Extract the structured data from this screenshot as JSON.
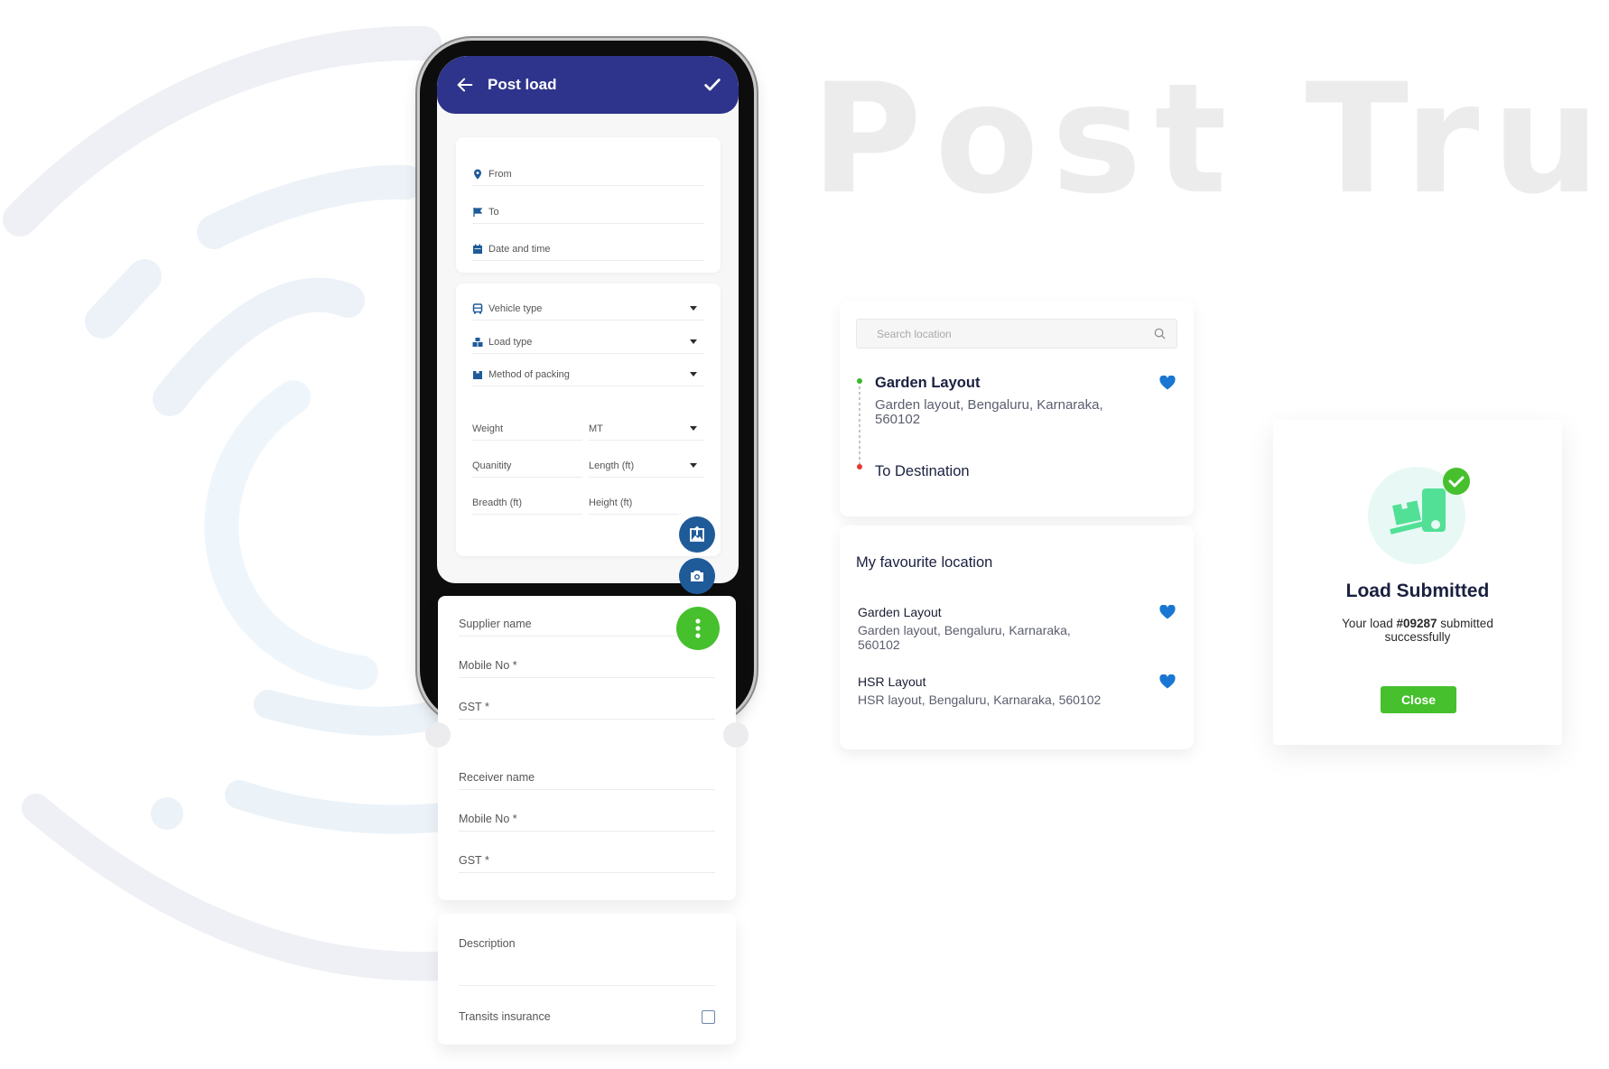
{
  "hero": {
    "title": "Post Truck"
  },
  "colors": {
    "header": "#2e348c",
    "accent_blue": "#1f5b99",
    "accent_green": "#46c02d",
    "heart_blue": "#1976d2",
    "route_start": "#3cb72c",
    "route_end": "#e53935"
  },
  "phone": {
    "header": {
      "title": "Post load",
      "back_icon": "arrow-left-icon",
      "confirm_icon": "check-icon"
    },
    "route_card": {
      "fields": [
        {
          "label": "From",
          "icon": "map-pin-icon"
        },
        {
          "label": "To",
          "icon": "flag-icon"
        },
        {
          "label": "Date and time",
          "icon": "calendar-icon"
        }
      ]
    },
    "load_card": {
      "dropdowns": [
        {
          "label": "Vehicle type",
          "icon": "truck-icon"
        },
        {
          "label": "Load type",
          "icon": "boxes-icon"
        },
        {
          "label": "Method of packing",
          "icon": "package-icon"
        }
      ],
      "weight": {
        "label": "Weight",
        "unit": "MT"
      },
      "quantity": {
        "label": "Quanitity"
      },
      "length": {
        "label": "Length (ft)"
      },
      "breadth": {
        "label": "Breadth (ft)"
      },
      "height": {
        "label": "Height (ft)"
      }
    },
    "fabs": {
      "upload": "image-upload-icon",
      "camera": "camera-icon",
      "more": "more-vertical-icon"
    }
  },
  "parties_card": {
    "supplier": {
      "name": "Supplier name",
      "mobile": "Mobile No *",
      "gst": "GST *"
    },
    "receiver": {
      "name": "Receiver name",
      "mobile": "Mobile No *",
      "gst": "GST *"
    }
  },
  "extra_card": {
    "description": "Description",
    "insurance": {
      "label": "Transits insurance",
      "checked": false
    }
  },
  "search_panel": {
    "placeholder": "Search location",
    "origin": {
      "name": "Garden Layout",
      "address": "Garden layout, Bengaluru, Karnaraka, 560102",
      "favourite": true
    },
    "destination": "To Destination"
  },
  "favourites_panel": {
    "title": "My favourite location",
    "items": [
      {
        "name": "Garden Layout",
        "address": "Garden layout, Bengaluru, Karnaraka, 560102",
        "favourite": true
      },
      {
        "name": "HSR Layout",
        "address": "HSR layout, Bengaluru, Karnaraka, 560102",
        "favourite": true
      }
    ]
  },
  "submitted_modal": {
    "title": "Load Submitted",
    "message_prefix": "Your load ",
    "load_id": "#09287",
    "message_suffix": " submitted successfully",
    "close_label": "Close"
  }
}
